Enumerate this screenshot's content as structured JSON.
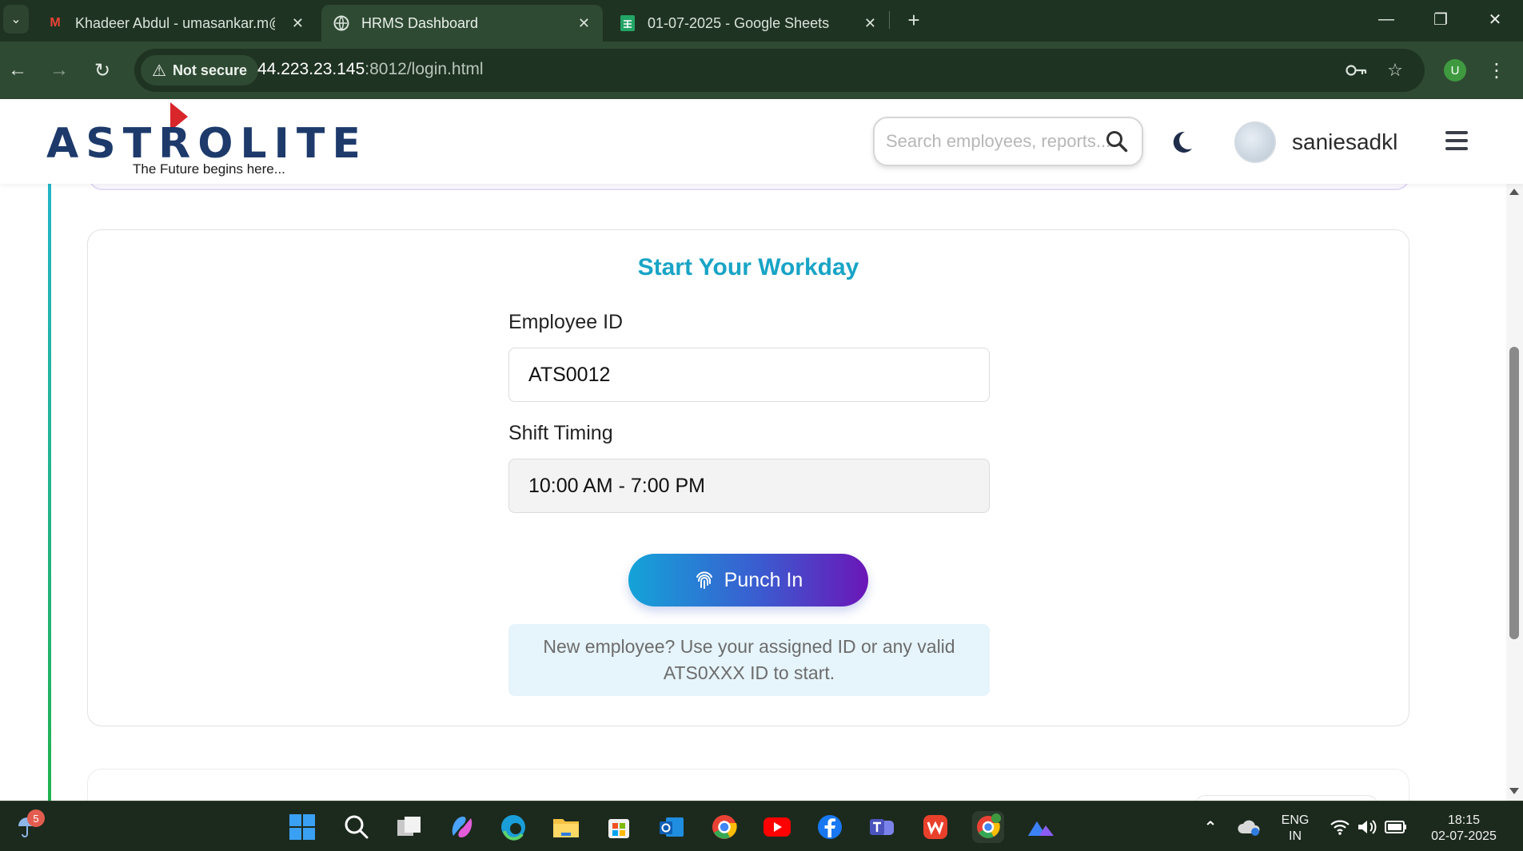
{
  "browser": {
    "tabs": [
      {
        "title": "Khadeer Abdul - umasankar.m@",
        "favicon": "gmail-icon",
        "active": false
      },
      {
        "title": "HRMS Dashboard",
        "favicon": "globe-icon",
        "active": true
      },
      {
        "title": "01-07-2025 - Google Sheets",
        "favicon": "sheets-icon",
        "active": false
      }
    ],
    "not_secure_label": "Not secure",
    "url_host": "44.223.23.145",
    "url_path": ":8012/login.html",
    "profile_initial": "U"
  },
  "header": {
    "logo_text": "ASTROLITE",
    "logo_tagline": "The Future begins here...",
    "search_placeholder": "Search employees, reports...",
    "username": "saniesadkl"
  },
  "card": {
    "title": "Start Your Workday",
    "employee_id_label": "Employee ID",
    "employee_id_value": "ATS0012",
    "shift_label": "Shift Timing",
    "shift_value": "10:00 AM - 7:00 PM",
    "punch_label": "Punch In",
    "hint_line1": "New employee? Use your assigned ID or any valid",
    "hint_line2": "ATS0XXX ID to start."
  },
  "taskbar": {
    "weather_badge": "5",
    "lang_line1": "ENG",
    "lang_line2": "IN",
    "time": "18:15",
    "date": "02-07-2025"
  },
  "colors": {
    "browser_frame": "#1f3322",
    "accent_title": "#18a4c6",
    "logo_blue": "#1d3a6b",
    "logo_red": "#d8262b",
    "punch_gradient_start": "#14a3d8",
    "punch_gradient_end": "#6b16b8",
    "hint_background": "#e6f4fb"
  }
}
